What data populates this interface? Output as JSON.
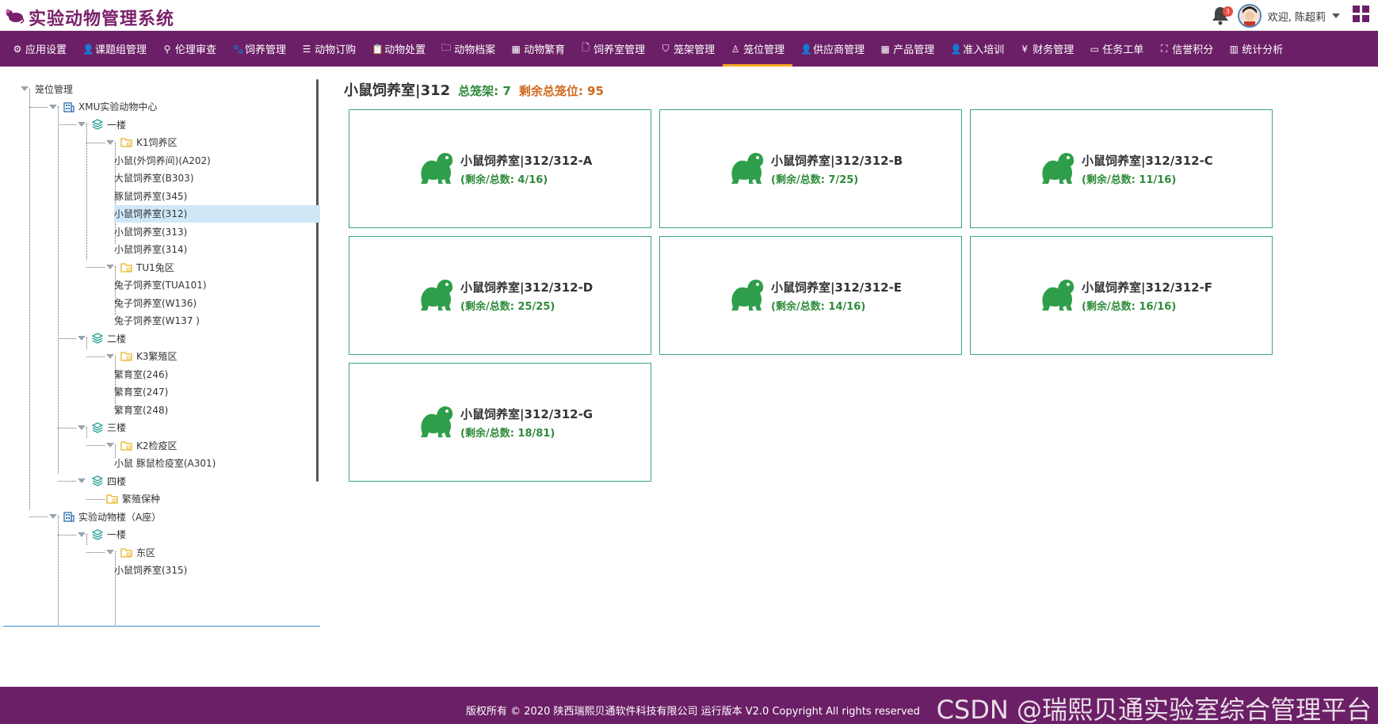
{
  "app": {
    "title": "实验动物管理系统"
  },
  "header": {
    "notification_count": "3",
    "welcome": "欢迎, 陈超莉"
  },
  "nav": [
    {
      "label": "应用设置",
      "icon": "gear-icon",
      "glyph": "⚙"
    },
    {
      "label": "课题组管理",
      "icon": "user-icon",
      "glyph": "👤"
    },
    {
      "label": "伦理审查",
      "icon": "search-icon",
      "glyph": "⚲"
    },
    {
      "label": "饲养管理",
      "icon": "paw-icon",
      "glyph": "🐾"
    },
    {
      "label": "动物订购",
      "icon": "list-icon",
      "glyph": "☰"
    },
    {
      "label": "动物处置",
      "icon": "clipboard-icon",
      "glyph": "📋"
    },
    {
      "label": "动物档案",
      "icon": "folder-icon",
      "glyph": "🗀"
    },
    {
      "label": "动物繁育",
      "icon": "grid-icon",
      "glyph": "▦"
    },
    {
      "label": "饲养室管理",
      "icon": "doc-icon",
      "glyph": "🗋"
    },
    {
      "label": "笼架管理",
      "icon": "shield-icon",
      "glyph": "⛉"
    },
    {
      "label": "笼位管理",
      "icon": "person-icon",
      "glyph": "♙"
    },
    {
      "label": "供应商管理",
      "icon": "user-icon",
      "glyph": "👤"
    },
    {
      "label": "产品管理",
      "icon": "grid-icon",
      "glyph": "▦"
    },
    {
      "label": "准入培训",
      "icon": "user-icon",
      "glyph": "👤"
    },
    {
      "label": "财务管理",
      "icon": "yen-icon",
      "glyph": "¥"
    },
    {
      "label": "任务工单",
      "icon": "ticket-icon",
      "glyph": "▭"
    },
    {
      "label": "信誉积分",
      "icon": "expand-icon",
      "glyph": "⛶"
    },
    {
      "label": "统计分析",
      "icon": "bar-chart-icon",
      "glyph": "▥"
    }
  ],
  "tree": [
    {
      "label": "笼位管理",
      "type": "root",
      "arrow": true
    },
    {
      "label": "XMU实验动物中心",
      "type": "building",
      "arrow": true
    },
    {
      "label": "一楼",
      "type": "floor",
      "arrow": true
    },
    {
      "label": "K1饲养区",
      "type": "zone",
      "arrow": true
    },
    {
      "label": "小鼠(外饲养间)(A202)",
      "type": "room"
    },
    {
      "label": "大鼠饲养室(B303)",
      "type": "room"
    },
    {
      "label": "豚鼠饲养室(345)",
      "type": "room"
    },
    {
      "label": "小鼠饲养室(312)",
      "type": "room",
      "selected": true
    },
    {
      "label": "小鼠饲养室(313)",
      "type": "room"
    },
    {
      "label": "小鼠饲养室(314)",
      "type": "room"
    },
    {
      "label": "TU1兔区",
      "type": "zone",
      "arrow": true
    },
    {
      "label": "兔子饲养室(TUA101)",
      "type": "room"
    },
    {
      "label": "兔子饲养室(W136)",
      "type": "room"
    },
    {
      "label": "兔子饲养室(W137 )",
      "type": "room"
    },
    {
      "label": "二楼",
      "type": "floor",
      "arrow": true
    },
    {
      "label": "K3繁殖区",
      "type": "zone",
      "arrow": true
    },
    {
      "label": "繁育室(246)",
      "type": "room"
    },
    {
      "label": "繁育室(247)",
      "type": "room"
    },
    {
      "label": "繁育室(248)",
      "type": "room"
    },
    {
      "label": "三楼",
      "type": "floor",
      "arrow": true
    },
    {
      "label": "K2检疫区",
      "type": "zone",
      "arrow": true
    },
    {
      "label": "小鼠 豚鼠检疫室(A301)",
      "type": "room"
    },
    {
      "label": "四楼",
      "type": "floor",
      "arrow": true
    },
    {
      "label": "繁殖保种",
      "type": "zone-leaf"
    },
    {
      "label": "实验动物楼（A座）",
      "type": "building",
      "arrow": true
    },
    {
      "label": "一楼",
      "type": "floor",
      "arrow": true
    },
    {
      "label": "东区",
      "type": "zone",
      "arrow": true
    },
    {
      "label": "小鼠饲养室(315)",
      "type": "room"
    }
  ],
  "main": {
    "room_name": "小鼠饲养室|312",
    "total_racks": "总笼架: 7",
    "remaining_slots": "剩余总笼位: 95",
    "racks": [
      {
        "title": "小鼠饲养室|312/312-A",
        "sub": "(剩余/总数:  4/16)"
      },
      {
        "title": "小鼠饲养室|312/312-B",
        "sub": "(剩余/总数:  7/25)"
      },
      {
        "title": "小鼠饲养室|312/312-C",
        "sub": "(剩余/总数:  11/16)"
      },
      {
        "title": "小鼠饲养室|312/312-D",
        "sub": "(剩余/总数:  25/25)"
      },
      {
        "title": "小鼠饲养室|312/312-E",
        "sub": "(剩余/总数:  14/16)"
      },
      {
        "title": "小鼠饲养室|312/312-F",
        "sub": "(剩余/总数:  16/16)"
      },
      {
        "title": "小鼠饲养室|312/312-G",
        "sub": "(剩余/总数:  18/81)"
      }
    ]
  },
  "footer": {
    "copyright": "版权所有 © 2020 陕西瑞熙贝通软件科技有限公司 运行版本 V2.0 Copyright All rights reserved",
    "watermark": "CSDN @瑞熙贝通实验室综合管理平台"
  },
  "colors": {
    "brand": "#6b1f66",
    "active_underline": "#f5a623",
    "rack_icon": "#2e9e4a",
    "remaining": "#d2691e"
  }
}
